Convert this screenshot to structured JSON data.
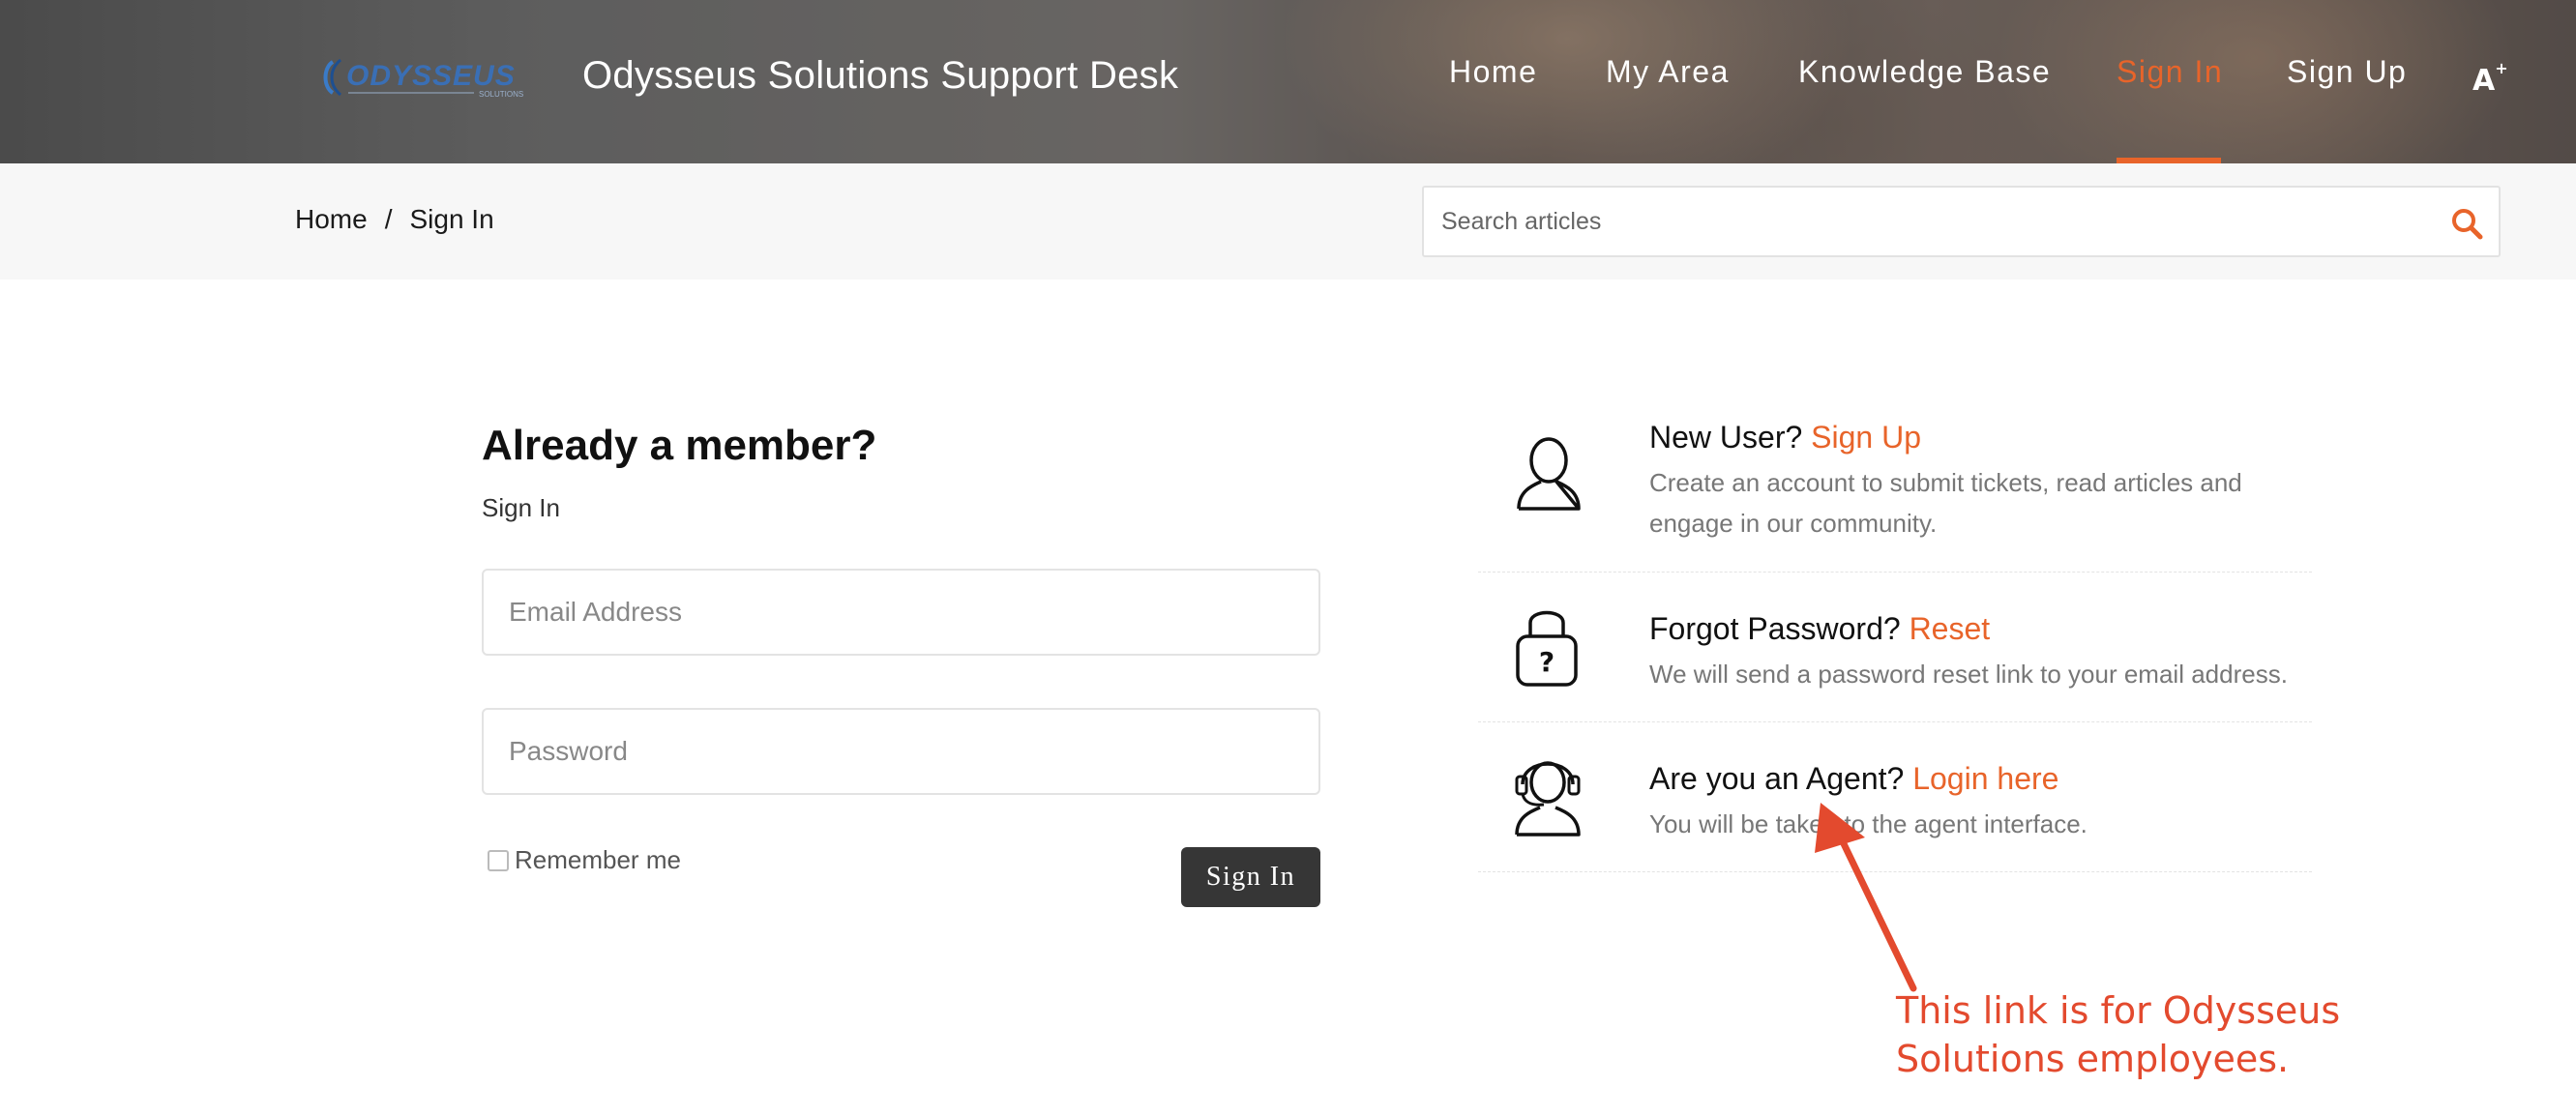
{
  "header": {
    "site_title": "Odysseus Solutions Support Desk",
    "logo_text": "ODYSSEUS",
    "logo_subtext": "SOLUTIONS",
    "nav": [
      {
        "label": "Home",
        "active": false
      },
      {
        "label": "My Area",
        "active": false
      },
      {
        "label": "Knowledge Base",
        "active": false
      },
      {
        "label": "Sign In",
        "active": true
      },
      {
        "label": "Sign Up",
        "active": false
      }
    ],
    "accessibility_icon": "A",
    "accent_color": "#e8642a"
  },
  "breadcrumb": {
    "items": [
      "Home",
      "Sign In"
    ],
    "separator": "/"
  },
  "search": {
    "placeholder": "Search articles",
    "icon": "search-icon"
  },
  "signin": {
    "title": "Already a member?",
    "subtitle": "Sign In",
    "email_placeholder": "Email Address",
    "password_placeholder": "Password",
    "remember_label": "Remember me",
    "button_label": "Sign In"
  },
  "info": [
    {
      "icon": "user-icon",
      "question": "New User? ",
      "link": "Sign Up",
      "desc": "Create an account to submit tickets, read articles and engage in our community."
    },
    {
      "icon": "lock-icon",
      "question": "Forgot Password? ",
      "link": "Reset",
      "desc": "We will send a password reset link to your email address."
    },
    {
      "icon": "headset-agent-icon",
      "question": "Are you an Agent? ",
      "link": "Login here",
      "desc": "You will be taken to the agent interface."
    }
  ],
  "annotation": {
    "text": "This link is for Odysseus Solutions employees.",
    "color": "#e34a2e"
  }
}
